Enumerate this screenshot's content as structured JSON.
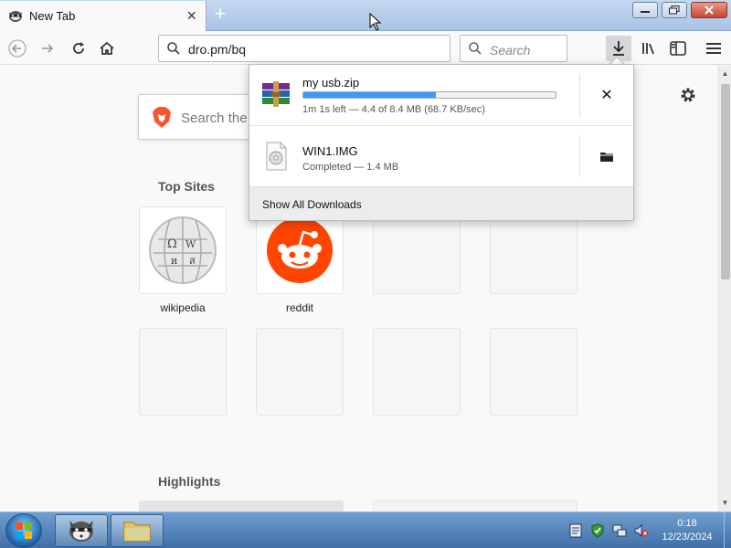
{
  "window": {
    "tab_title": "New Tab",
    "tab_close": "×",
    "new_tab": "+"
  },
  "toolbar": {
    "url": "dro.pm/bq",
    "search_placeholder": "Search"
  },
  "newtab": {
    "search_placeholder": "Search the Web",
    "top_sites_title": "Top Sites",
    "highlights_title": "Highlights",
    "sites": [
      {
        "label": "wikipedia",
        "icon": "wikipedia-globe-icon"
      },
      {
        "label": "reddit",
        "icon": "reddit-alien-icon"
      }
    ]
  },
  "downloads": {
    "items": [
      {
        "name": "my usb.zip",
        "status": "1m 1s left — 4.4 of 8.4 MB (68.7 KB/sec)",
        "progress_fraction": 0.524,
        "icon": "winrar-archive-icon",
        "action": "cancel",
        "action_glyph": "✕"
      },
      {
        "name": "WIN1.IMG",
        "status": "Completed — 1.4 MB",
        "icon": "disc-image-file-icon",
        "action": "open-folder"
      }
    ],
    "footer": "Show All Downloads"
  },
  "taskbar": {
    "time": "0:18",
    "date": "12/23/2024"
  },
  "colors": {
    "progress": "#3b99fc",
    "reddit": "#ff4500",
    "brave": "#fb542b"
  }
}
